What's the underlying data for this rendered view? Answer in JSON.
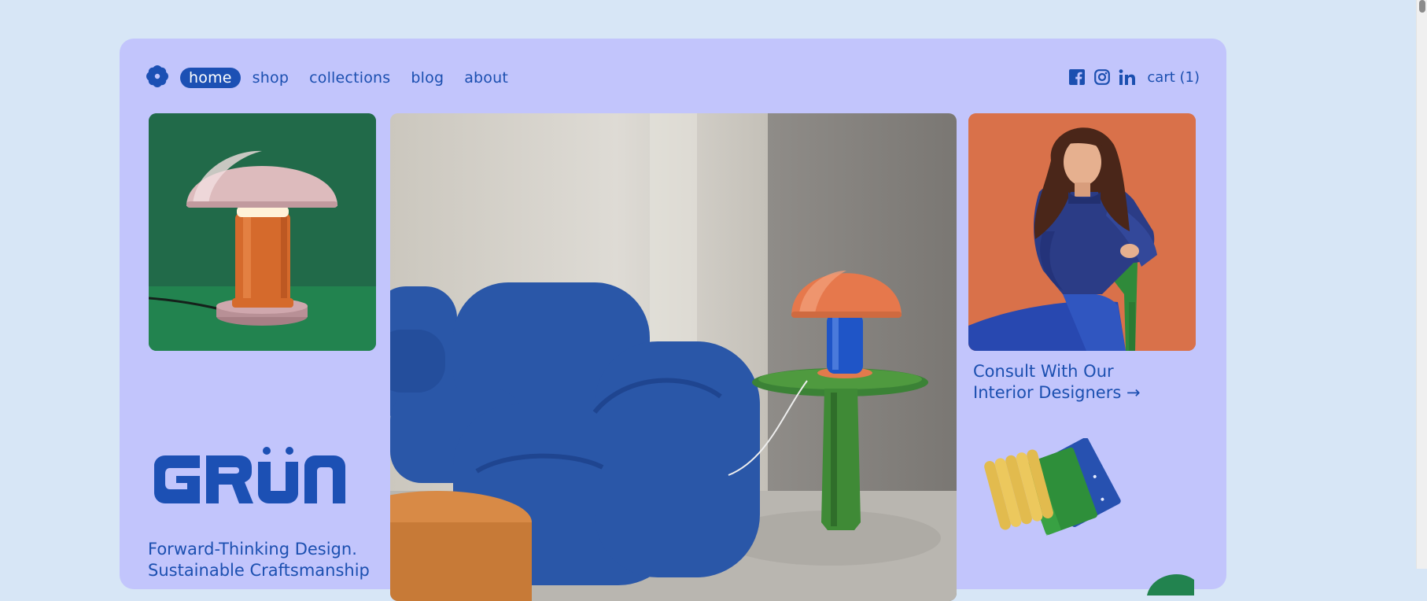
{
  "nav": {
    "logo_icon": "flower-icon",
    "links": [
      {
        "label": "home",
        "active": true
      },
      {
        "label": "shop",
        "active": false
      },
      {
        "label": "collections",
        "active": false
      },
      {
        "label": "blog",
        "active": false
      },
      {
        "label": "about",
        "active": false
      }
    ],
    "social_icons": [
      "facebook-icon",
      "instagram-icon",
      "linkedin-icon"
    ],
    "cart_label": "cart (1)"
  },
  "cards": {
    "lamp": {
      "image": "orange-mushroom-lamp-on-green"
    },
    "hero": {
      "image": "blue-sofa-with-green-side-table-and-lamp"
    },
    "portrait": {
      "image": "woman-in-blue-sweater-on-green-chair"
    }
  },
  "consult": {
    "line1": "Consult With Our",
    "line2": "Interior Designers",
    "arrow": "→"
  },
  "brand": {
    "logo_text": "GRÜN",
    "tagline_line1": "Forward-Thinking Design.",
    "tagline_line2": "Sustainable Craftsmanship"
  },
  "colors": {
    "page_bg": "#d7e6f6",
    "panel_bg": "#c2c5fc",
    "accent": "#1c50b4",
    "lamp_bg": "#236d4c",
    "portrait_bg": "#d96f47"
  }
}
